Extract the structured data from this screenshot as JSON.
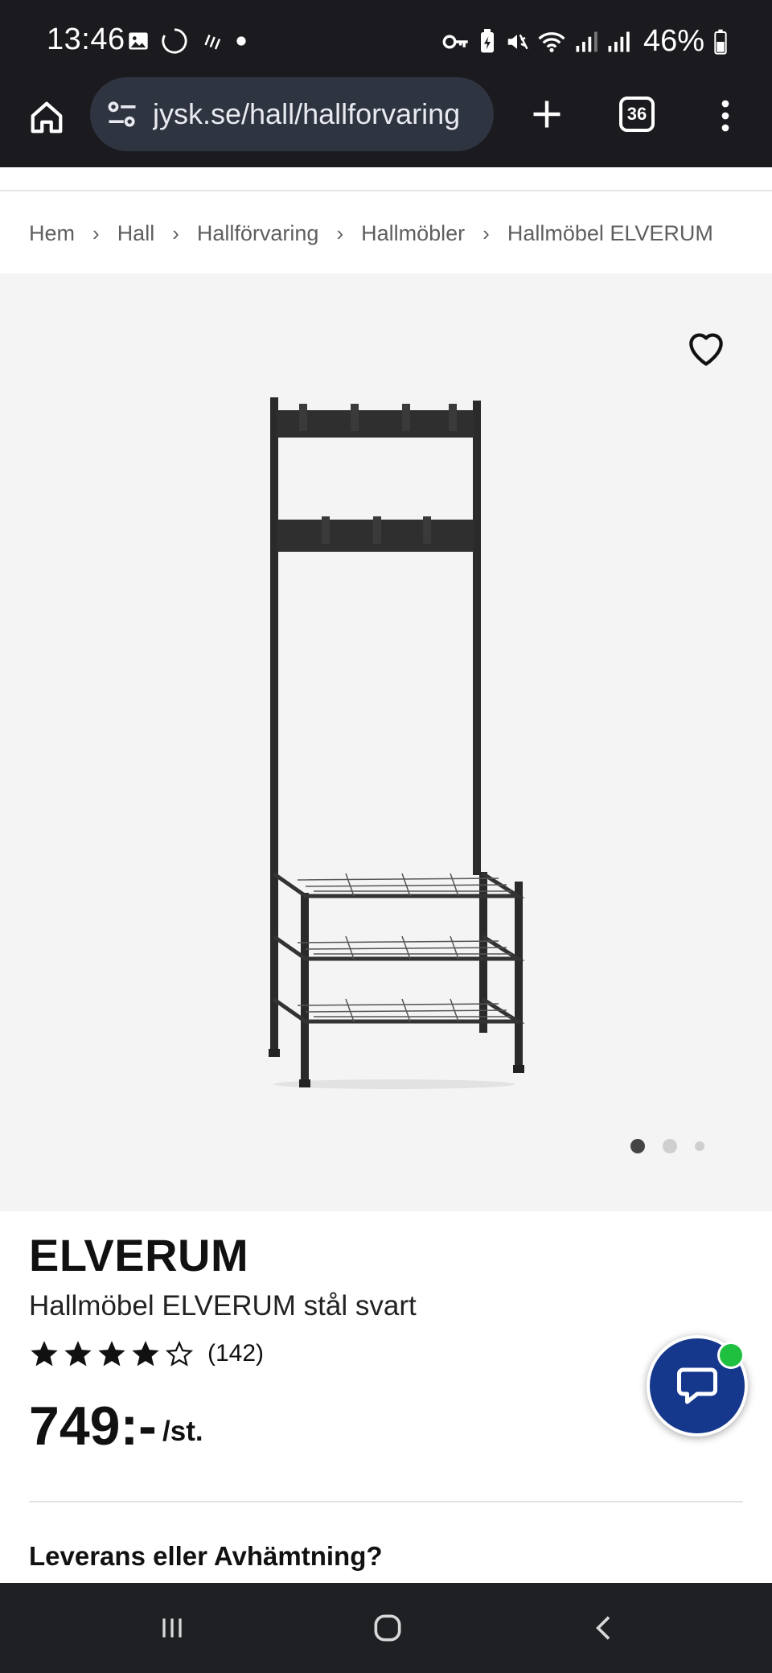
{
  "status_bar": {
    "time": "13:46",
    "battery": "46%",
    "left_icons": [
      "gallery-icon",
      "loading-icon",
      "data-saver-icon",
      "dot-icon"
    ],
    "right_icons": [
      "key-icon",
      "battery-saver-icon",
      "mute-icon",
      "wifi-icon",
      "signal-icon",
      "signal-icon",
      "battery-icon"
    ]
  },
  "browser": {
    "url": "jysk.se/hall/hallforvaring",
    "tab_count": "36"
  },
  "breadcrumb": {
    "items": [
      "Hem",
      "Hall",
      "Hallförvaring",
      "Hallmöbler",
      "Hallmöbel ELVERUM"
    ],
    "separator": "›"
  },
  "gallery": {
    "image_count": 3,
    "active_index": 0
  },
  "product": {
    "brand": "ELVERUM",
    "name": "Hallmöbel ELVERUM stål svart",
    "rating": 4,
    "rating_max": 5,
    "review_count": "(142)",
    "price": "749:-",
    "unit": "/st."
  },
  "delivery": {
    "heading": "Leverans eller Avhämtning?"
  },
  "colors": {
    "chrome_bg": "#1b1b1f",
    "urlbar_bg": "#2f3441",
    "gallery_bg": "#f4f4f4",
    "chat_bg": "#15378c",
    "online_dot": "#1fbf3f"
  }
}
